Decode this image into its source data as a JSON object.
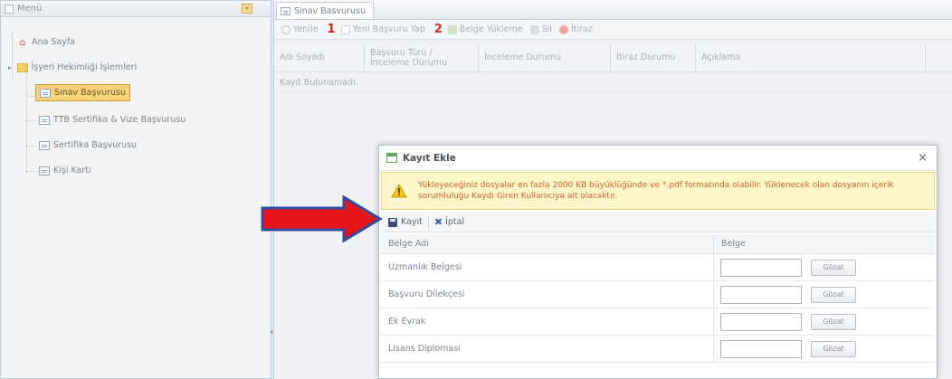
{
  "menu_panel": {
    "title": "Menü",
    "collapse_glyph": "«",
    "items": [
      {
        "label": "Ana Sayfa",
        "icon": "home-icon"
      },
      {
        "label": "İşyeri Hekimliği İşlemleri",
        "icon": "folder-icon"
      },
      {
        "label": "Sınav Başvurusu",
        "icon": "page-icon",
        "selected": true
      },
      {
        "label": "TTB Sertifika & Vize Başvurusu",
        "icon": "page-icon"
      },
      {
        "label": "Sertifika Başvurusu",
        "icon": "page-icon"
      },
      {
        "label": "Kişi Kartı",
        "icon": "page-icon"
      }
    ]
  },
  "main": {
    "tab_label": "Sinav Basvurusu",
    "toolbar": {
      "refresh": "Yenile",
      "marker1": "1",
      "new_application": "Yeni Başvuru Yap",
      "marker2": "2",
      "upload_document": "Belge Yükleme",
      "delete": "Sil",
      "objection": "İtiraz"
    },
    "grid": {
      "columns": [
        "Adı Soyadı",
        "Başvuru Türü / İnceleme Durumu",
        "İnceleme Durumu",
        "İtiraz Durumu",
        "Açıklama"
      ],
      "empty_text": "Kayıt Bulunamadı."
    }
  },
  "modal": {
    "title": "Kayıt Ekle",
    "close_glyph": "×",
    "warning_line1": "Yükleyeceğiniz dosyalar en fazla 2000 KB büyüklüğünde ve *.pdf formatında olabilir. Yüklenecek olan dosyanın içerik",
    "warning_line2": "sorumluluğu Kaydı Giren Kullanıcıya ait olacaktır.",
    "save_label": "Kayıt",
    "cancel_label": "İptal",
    "table": {
      "col_name": "Belge Adı",
      "col_file": "Belge",
      "browse_label": "Gözat",
      "rows": [
        {
          "name": "Uzmanlık Belgesi",
          "value": ""
        },
        {
          "name": "Başvuru Dilekçesi",
          "value": ""
        },
        {
          "name": "Ek Evrak",
          "value": ""
        },
        {
          "name": "Lisans Diploması",
          "value": ""
        }
      ]
    }
  },
  "colors": {
    "selected_bg": "#f6d27a",
    "marker_red": "#e0211b",
    "warning_text": "#d25f2a",
    "arrow_fill": "#e8141b",
    "arrow_stroke": "#2f4d9c"
  }
}
